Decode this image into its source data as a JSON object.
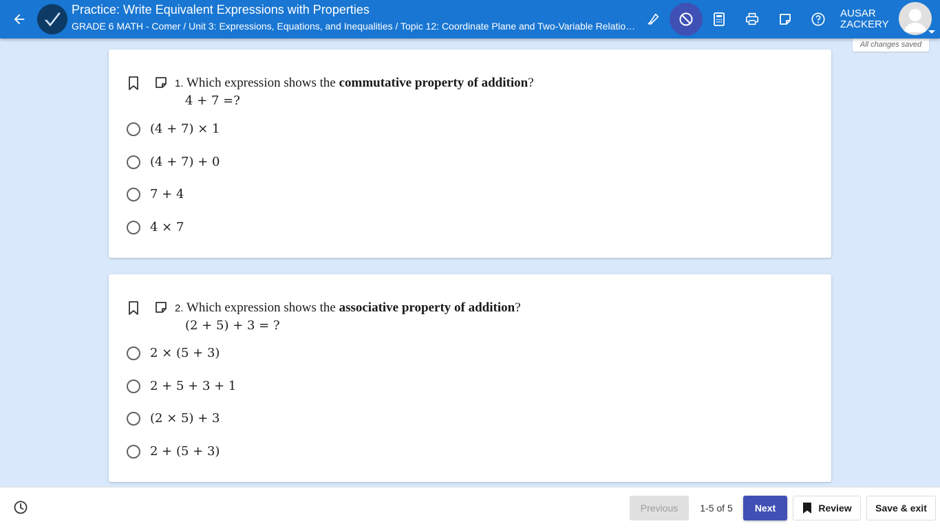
{
  "header": {
    "title": "Practice: Write Equivalent Expressions with Properties",
    "breadcrumb": "GRADE 6 MATH - Comer / Unit 3: Expressions, Equations, and Inequalities / Topic 12: Coordinate Plane and Two-Variable Relations...",
    "user_first": "AUSAR",
    "user_last": "ZACKERY",
    "save_status": "All changes saved",
    "tools": [
      "highlighter-icon",
      "line-reader-icon",
      "calculator-icon",
      "print-icon",
      "notepad-icon",
      "help-icon"
    ],
    "colors": {
      "bar": "#1976d2",
      "active_tool": "#3f51b5"
    }
  },
  "questions": [
    {
      "number": "1.",
      "prompt_before": "Which expression shows the ",
      "prompt_bold": "commutative property of addition",
      "prompt_after": "?",
      "expression": "4 + 7 =?",
      "choices": [
        "(4 + 7) × 1",
        "(4 + 7) + 0",
        "7 + 4",
        "4 × 7"
      ]
    },
    {
      "number": "2.",
      "prompt_before": "Which expression shows the ",
      "prompt_bold": "associative property of addition",
      "prompt_after": "?",
      "expression": "(2 + 5) + 3 = ?",
      "choices": [
        "2 × (5 + 3)",
        "2 + 5 + 3 + 1",
        "(2 × 5) + 3",
        "2 + (5 + 3)"
      ]
    }
  ],
  "footer": {
    "previous_label": "Previous",
    "page_indicator": "1-5 of 5",
    "next_label": "Next",
    "review_label": "Review",
    "save_exit_label": "Save & exit",
    "accent": "#3f51b5"
  }
}
